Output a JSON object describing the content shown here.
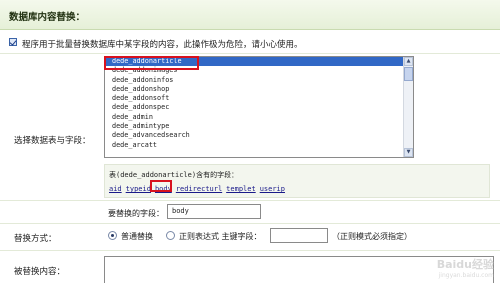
{
  "header": {
    "title": "数据库内容替换："
  },
  "notice": {
    "text": "程序用于批量替换数据库中某字段的内容，此操作极为危险，请小心使用。"
  },
  "select_table": {
    "label": "选择数据表与字段：",
    "items": [
      "dede_addonarticle",
      "dede_addonimages",
      "dede_addoninfos",
      "dede_addonshop",
      "dede_addonsoft",
      "dede_addonspec",
      "dede_admin",
      "dede_admintype",
      "dede_advancedsearch",
      "dede_arcatt"
    ],
    "selected_index": 0
  },
  "fields": {
    "title": "表(dede_addonarticle)含有的字段：",
    "links": [
      "aid",
      "typeid",
      "body",
      "redirecturl",
      "templet",
      "userip"
    ]
  },
  "replace_field": {
    "label": "要替换的字段：",
    "value": "body"
  },
  "replace_mode": {
    "label": "替换方式：",
    "option_normal": "普通替换",
    "option_regex": "正则表达式 主键字段：",
    "regex_note": "（正则模式必须指定）"
  },
  "content": {
    "label": "被替换内容："
  },
  "watermark": {
    "main": "Baidu经验",
    "sub": "jingyan.baidu.com"
  }
}
